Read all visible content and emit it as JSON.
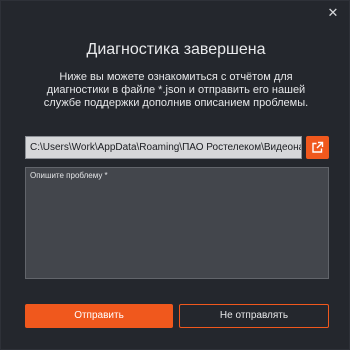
{
  "dialog": {
    "close_icon": "close-icon",
    "title": "Диагностика завершена",
    "description": "Ниже вы можете ознакомиться с отчётом для диагностики в файле *.json и отправить его нашей службе поддержки дополнив описанием проблемы.",
    "file_path": "C:\\Users\\Work\\AppData\\Roaming\\ПАО Ростелеком\\Видеонаблюдение",
    "open_icon": "external-link-icon",
    "problem_placeholder": "Опишите проблему *",
    "send_label": "Отправить",
    "cancel_label": "Не отправлять"
  },
  "colors": {
    "accent": "#f0581d",
    "background": "#24272d",
    "field": "#43464c"
  }
}
